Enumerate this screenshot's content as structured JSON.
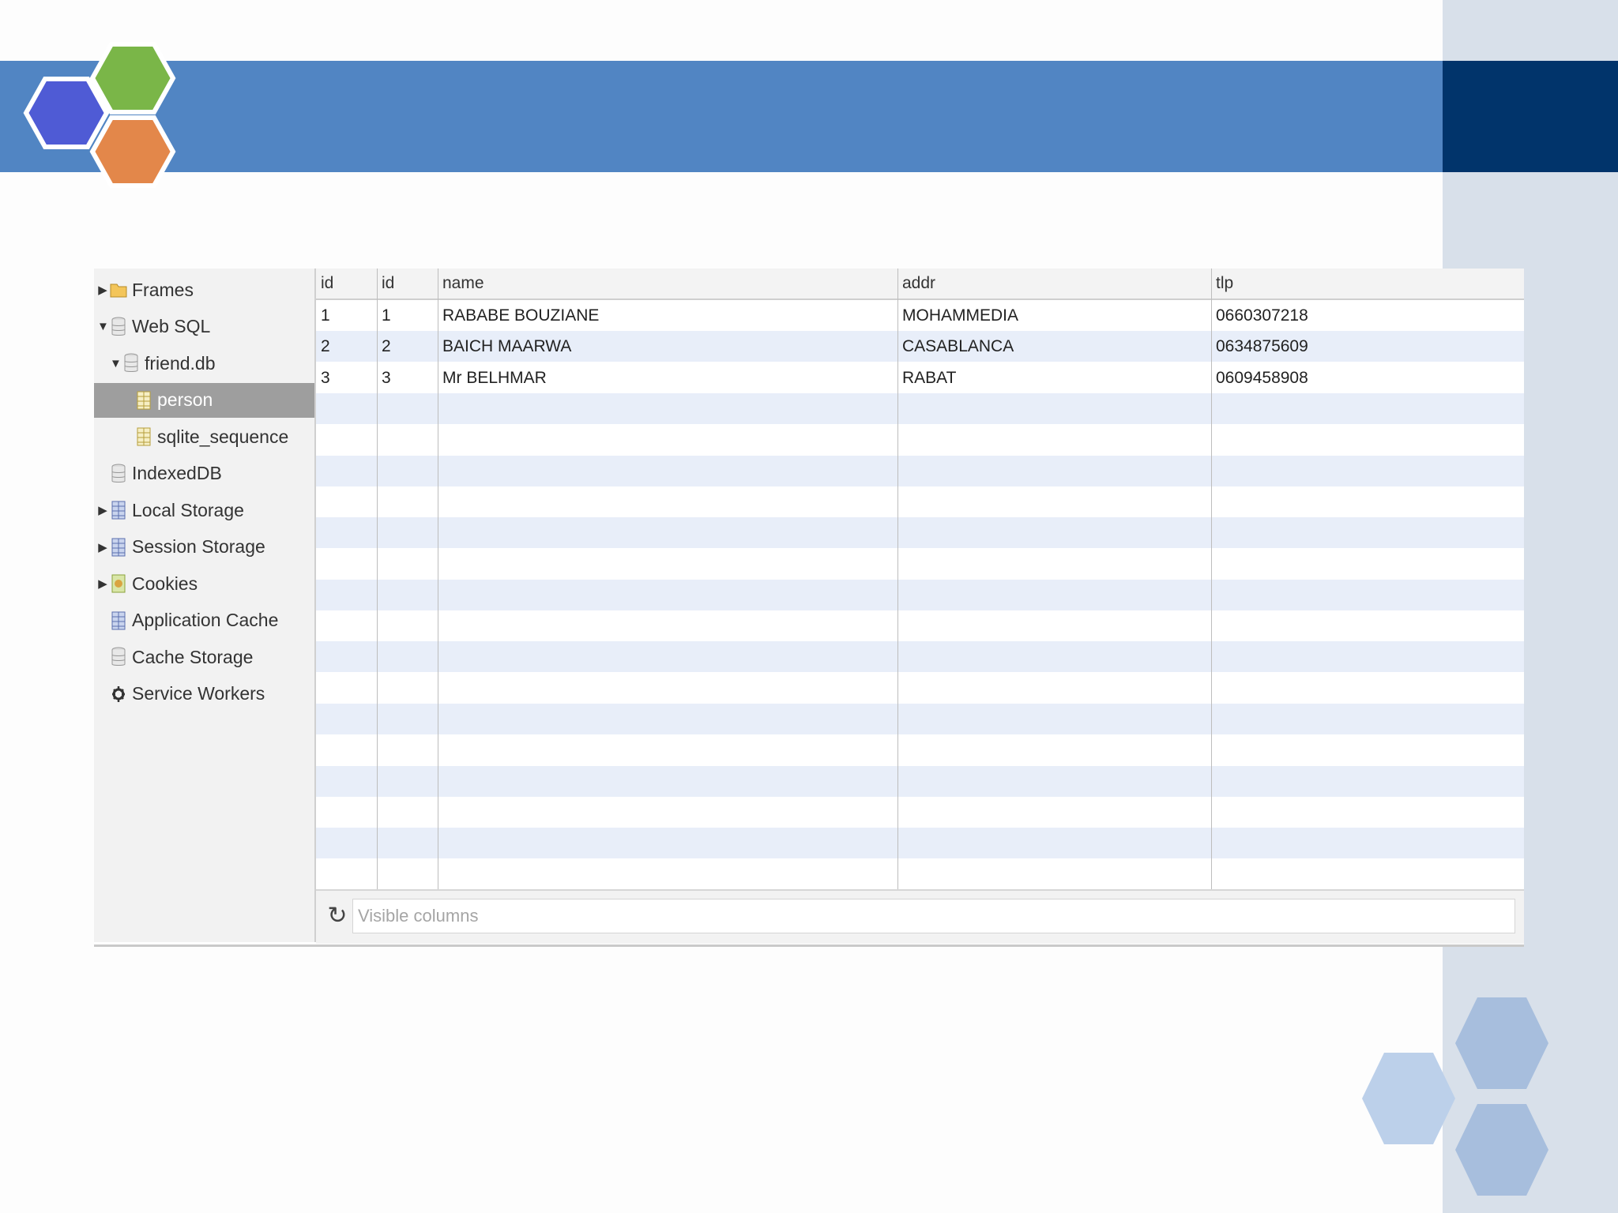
{
  "sidebar": {
    "items": [
      {
        "label": "Frames",
        "icon": "folder-icon",
        "arrow": "▶"
      },
      {
        "label": "Web SQL",
        "icon": "database-icon",
        "arrow": "▼"
      },
      {
        "label": "friend.db",
        "icon": "database-icon",
        "arrow": "▼"
      },
      {
        "label": "person",
        "icon": "table-icon",
        "arrow": ""
      },
      {
        "label": "sqlite_sequence",
        "icon": "table-icon",
        "arrow": ""
      },
      {
        "label": "IndexedDB",
        "icon": "database-icon",
        "arrow": ""
      },
      {
        "label": "Local Storage",
        "icon": "grid-storage-icon",
        "arrow": "▶"
      },
      {
        "label": "Session Storage",
        "icon": "grid-storage-icon",
        "arrow": "▶"
      },
      {
        "label": "Cookies",
        "icon": "cookie-icon",
        "arrow": "▶"
      },
      {
        "label": "Application Cache",
        "icon": "grid-storage-icon",
        "arrow": ""
      },
      {
        "label": "Cache Storage",
        "icon": "database-icon",
        "arrow": ""
      },
      {
        "label": "Service Workers",
        "icon": "gear-icon",
        "arrow": ""
      }
    ],
    "selected": "person"
  },
  "table": {
    "columns": [
      "id",
      "id",
      "name",
      "addr",
      "tlp"
    ],
    "rows": [
      [
        "1",
        "1",
        "RABABE BOUZIANE",
        "MOHAMMEDIA",
        "0660307218"
      ],
      [
        "2",
        "2",
        "BAICH MAARWA",
        "CASABLANCA",
        "0634875609"
      ],
      [
        "3",
        "3",
        "Mr BELHMAR",
        "RABAT",
        "0609458908"
      ]
    ]
  },
  "footer": {
    "refresh_icon": "refresh-icon",
    "filter_placeholder": "Visible columns"
  },
  "colors": {
    "band": "#5185c3",
    "band_dark": "#01346b",
    "hex_blue": "#4f5bd5",
    "hex_green": "#7ab648",
    "hex_orange": "#e3874a",
    "row_alt": "#e8eef9"
  }
}
